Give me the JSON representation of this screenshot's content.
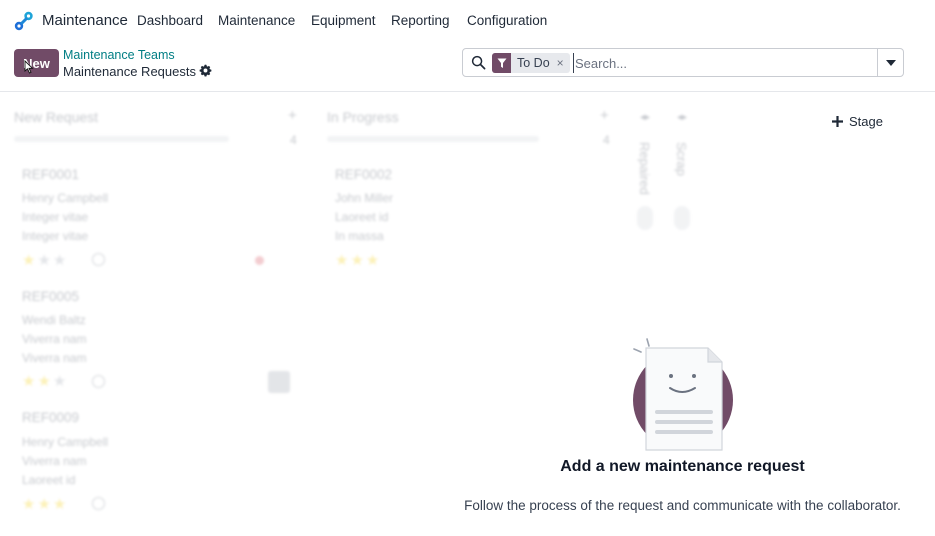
{
  "app": {
    "name": "Maintenance",
    "logo_icon": "maintenance-logo-icon",
    "accent": "#714b67"
  },
  "nav": [
    {
      "label": "Dashboard"
    },
    {
      "label": "Maintenance"
    },
    {
      "label": "Equipment"
    },
    {
      "label": "Reporting"
    },
    {
      "label": "Configuration"
    }
  ],
  "control": {
    "new_label": "New",
    "breadcrumb_parent": "Maintenance Teams",
    "breadcrumb_current": "Maintenance Requests"
  },
  "search": {
    "facet_label": "To Do",
    "facet_remove": "×",
    "placeholder": "Search...",
    "value": ""
  },
  "columns": [
    {
      "title": "New Request",
      "count": "4",
      "cards": [
        {
          "ref": "REF0001",
          "user": "Henry Campbell",
          "line1": "Integer vitae",
          "line2": "Integer vitae"
        },
        {
          "ref": "REF0005",
          "user": "Wendi Baltz",
          "line1": "Viverra nam",
          "line2": "Viverra nam"
        },
        {
          "ref": "REF0009",
          "user": "Henry Campbell",
          "line1": "Viverra nam",
          "line2": "Laoreet id"
        }
      ]
    },
    {
      "title": "In Progress",
      "count": "4",
      "cards": [
        {
          "ref": "REF0002",
          "user": "John Miller",
          "line1": "Laoreet id",
          "line2": "In massa"
        }
      ]
    }
  ],
  "folded_columns": [
    {
      "label": "Repaired"
    },
    {
      "label": "Scrap"
    }
  ],
  "add_stage_label": "Stage",
  "helper": {
    "title": "Add a new maintenance request",
    "text": "Follow the process of the request and communicate with the collaborator."
  }
}
